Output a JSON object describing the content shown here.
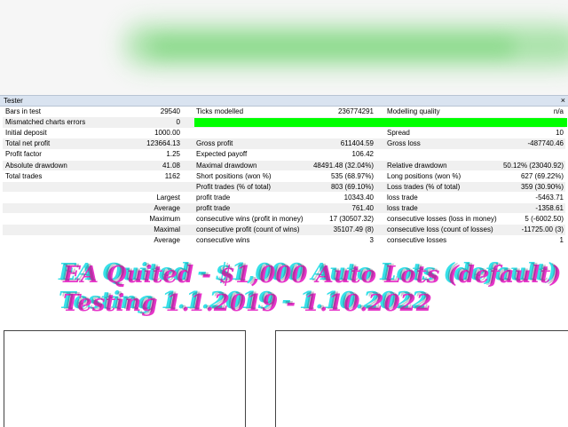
{
  "tester": {
    "title": "Tester",
    "close_glyph": "×"
  },
  "rows": [
    {
      "c1": "Bars in test",
      "v1": "29540",
      "c2": "Ticks modelled",
      "v2": "236774291",
      "c3": "Modelling quality",
      "v3": "n/a"
    },
    {
      "c1": "Mismatched charts errors",
      "v1": "0"
    },
    {
      "c1": "Initial deposit",
      "v1": "1000.00",
      "c3": "Spread",
      "v3": "10"
    },
    {
      "c1": "Total net profit",
      "v1": "123664.13",
      "c2": "Gross profit",
      "v2": "611404.59",
      "c3": "Gross loss",
      "v3": "-487740.46"
    },
    {
      "c1": "Profit factor",
      "v1": "1.25",
      "c2": "Expected payoff",
      "v2": "106.42"
    },
    {
      "c1": "Absolute drawdown",
      "v1": "41.08",
      "c2": "Maximal drawdown",
      "v2": "48491.48 (32.04%)",
      "c3": "Relative drawdown",
      "v3": "50.12% (23040.92)"
    },
    {
      "c1": "Total trades",
      "v1": "1162",
      "c2": "Short positions (won %)",
      "v2": "535 (68.97%)",
      "c3": "Long positions (won %)",
      "v3": "627 (69.22%)"
    },
    {
      "v1": "",
      "c2": "Profit trades (% of total)",
      "v2": "803 (69.10%)",
      "c3": "Loss trades (% of total)",
      "v3": "359 (30.90%)"
    },
    {
      "v1": "Largest",
      "c2": "profit trade",
      "v2": "10343.40",
      "c3": "loss trade",
      "v3": "-5463.71"
    },
    {
      "v1": "Average",
      "c2": "profit trade",
      "v2": "761.40",
      "c3": "loss trade",
      "v3": "-1358.61"
    },
    {
      "v1": "Maximum",
      "c2": "consecutive wins (profit in money)",
      "v2": "17 (30507.32)",
      "c3": "consecutive losses (loss in money)",
      "v3": "5 (-6002.50)"
    },
    {
      "v1": "Maximal",
      "c2": "consecutive profit (count of wins)",
      "v2": "35107.49 (8)",
      "c3": "consecutive loss (count of losses)",
      "v3": "-11725.00 (3)"
    },
    {
      "v1": "Average",
      "c2": "consecutive wins",
      "v2": "3",
      "c3": "consecutive losses",
      "v3": "1"
    }
  ],
  "overlay": {
    "line1": "EA Quited - $1,000 Auto Lots (default)",
    "line2": "Testing 1.1.2019 - 1.10.2022"
  },
  "colors": {
    "quality_bar": "#00ff00",
    "overlay_cyan": "#36e0e8",
    "overlay_magenta": "#e634c9",
    "titlebar": "#d9e3f0"
  }
}
